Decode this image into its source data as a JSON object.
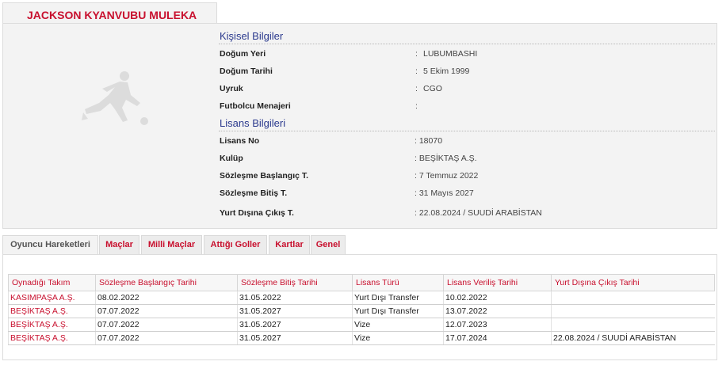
{
  "player": {
    "name": "JACKSON KYANVUBU MULEKA"
  },
  "personal": {
    "title": "Kişisel Bilgiler",
    "rows": [
      {
        "label": "Doğum Yeri",
        "value": "LUBUMBASHI"
      },
      {
        "label": "Doğum Tarihi",
        "value": "5 Ekim 1999"
      },
      {
        "label": "Uyruk",
        "value": "CGO"
      },
      {
        "label": "Futbolcu Menajeri",
        "value": ""
      }
    ]
  },
  "license": {
    "title": "Lisans Bilgileri",
    "rows": [
      {
        "label": "Lisans No",
        "value": ": 18070"
      },
      {
        "label": "Kulüp",
        "value": ": BEŞİKTAŞ A.Ş."
      },
      {
        "label": "Sözleşme Başlangıç T.",
        "value": ": 7 Temmuz 2022"
      },
      {
        "label": "Sözleşme Bitiş T.",
        "value": ": 31 Mayıs 2027"
      },
      {
        "label": "Yurt Dışına Çıkış T.",
        "value": ": 22.08.2024 / SUUDİ ARABİSTAN"
      }
    ]
  },
  "colon": ":",
  "tabs": [
    {
      "label": "Oyuncu Hareketleri"
    },
    {
      "label": "Maçlar"
    },
    {
      "label": "Milli Maçlar"
    },
    {
      "label": "Attığı Goller"
    },
    {
      "label": "Kartlar"
    },
    {
      "label": "Genel"
    }
  ],
  "movements": {
    "headers": [
      "Oynadığı Takım",
      "Sözleşme Başlangıç Tarihi",
      "Sözleşme Bitiş Tarihi",
      "Lisans Türü",
      "Lisans Veriliş Tarihi",
      "Yurt Dışına Çıkış Tarihi"
    ],
    "rows": [
      [
        "KASIMPAŞA A.Ş.",
        "08.02.2022",
        "31.05.2022",
        "Yurt Dışı Transfer",
        "10.02.2022",
        ""
      ],
      [
        "BEŞİKTAŞ A.Ş.",
        "07.07.2022",
        "31.05.2027",
        "Yurt Dışı Transfer",
        "13.07.2022",
        ""
      ],
      [
        "BEŞİKTAŞ A.Ş.",
        "07.07.2022",
        "31.05.2027",
        "Vize",
        "12.07.2023",
        ""
      ],
      [
        "BEŞİKTAŞ A.Ş.",
        "07.07.2022",
        "31.05.2027",
        "Vize",
        "17.07.2024",
        "22.08.2024 / SUUDİ ARABİSTAN"
      ]
    ]
  },
  "icons": {
    "player_placeholder": "player-silhouette-icon"
  }
}
